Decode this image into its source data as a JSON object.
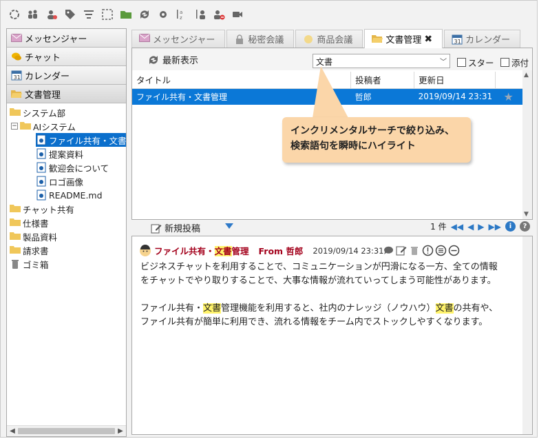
{
  "toolbar": {
    "icons": [
      "connect-icon",
      "users-icon",
      "user-group-icon",
      "tag-icon",
      "filter-select-icon",
      "selection-icon",
      "folder-open-icon",
      "sync-icon",
      "settings-icon",
      "sort-alpha-icon",
      "sort-user-icon",
      "user-remove-icon",
      "video-icon"
    ]
  },
  "sidebar": {
    "accordion": [
      {
        "label": "メッセンジャー"
      },
      {
        "label": "チャット"
      },
      {
        "label": "カレンダー"
      },
      {
        "label": "文書管理"
      }
    ],
    "tree": {
      "system_dept": "システム部",
      "ai_system": "AIシステム",
      "file_share": "ファイル共有・文書",
      "proposal": "提案資料",
      "welcome": "歓迎会について",
      "logo": "ロゴ画像",
      "readme": "README.md",
      "chat_share": "チャット共有",
      "spec": "仕様書",
      "product": "製品資料",
      "invoice": "請求書",
      "trash": "ゴミ箱"
    }
  },
  "tabs": [
    {
      "label": "メッセンジャー"
    },
    {
      "label": "秘密会議"
    },
    {
      "label": "商品会議"
    },
    {
      "label": "文書管理"
    },
    {
      "label": "カレンダー"
    }
  ],
  "docpane": {
    "refresh_label": "最新表示",
    "search_value": "文書",
    "star_label": "スター",
    "attach_label": "添付",
    "columns": {
      "title": "タイトル",
      "poster": "投稿者",
      "updated": "更新日"
    },
    "rows": [
      {
        "title": "ファイル共有・文書管理",
        "poster": "哲郎",
        "updated": "2019/09/14 23:31"
      }
    ]
  },
  "callout": {
    "line1": "インクリメンタルサーチで絞り込み、",
    "line2": "検索語句を瞬時にハイライト"
  },
  "midbar": {
    "new_post": "新規投稿",
    "count": "1 件"
  },
  "message": {
    "subject_pre": "ファイル共有・",
    "subject_hl": "文書",
    "subject_post": "管理",
    "from": "From 哲郎",
    "date": "2019/09/14 23:31",
    "p1": "ビジネスチャットを利用することで、コミュニケーションが円滑になる一方、全ての情報",
    "p2": "をチャットでやり取りすることで、大事な情報が流れていってしまう可能性があります。",
    "p3a": "ファイル共有・",
    "p3hl": "文書",
    "p3b": "管理機能を利用すると、社内のナレッジ（ノウハウ）",
    "p3hl2": "文書",
    "p3c": "の共有や、",
    "p4": "ファイル共有が簡単に利用でき、流れる情報をチーム内でストックしやすくなります。"
  },
  "colors": {
    "selection": "#0b78d7",
    "subject": "#a3001b",
    "highlight": "#fff36b",
    "callout": "#fbd6a9"
  }
}
